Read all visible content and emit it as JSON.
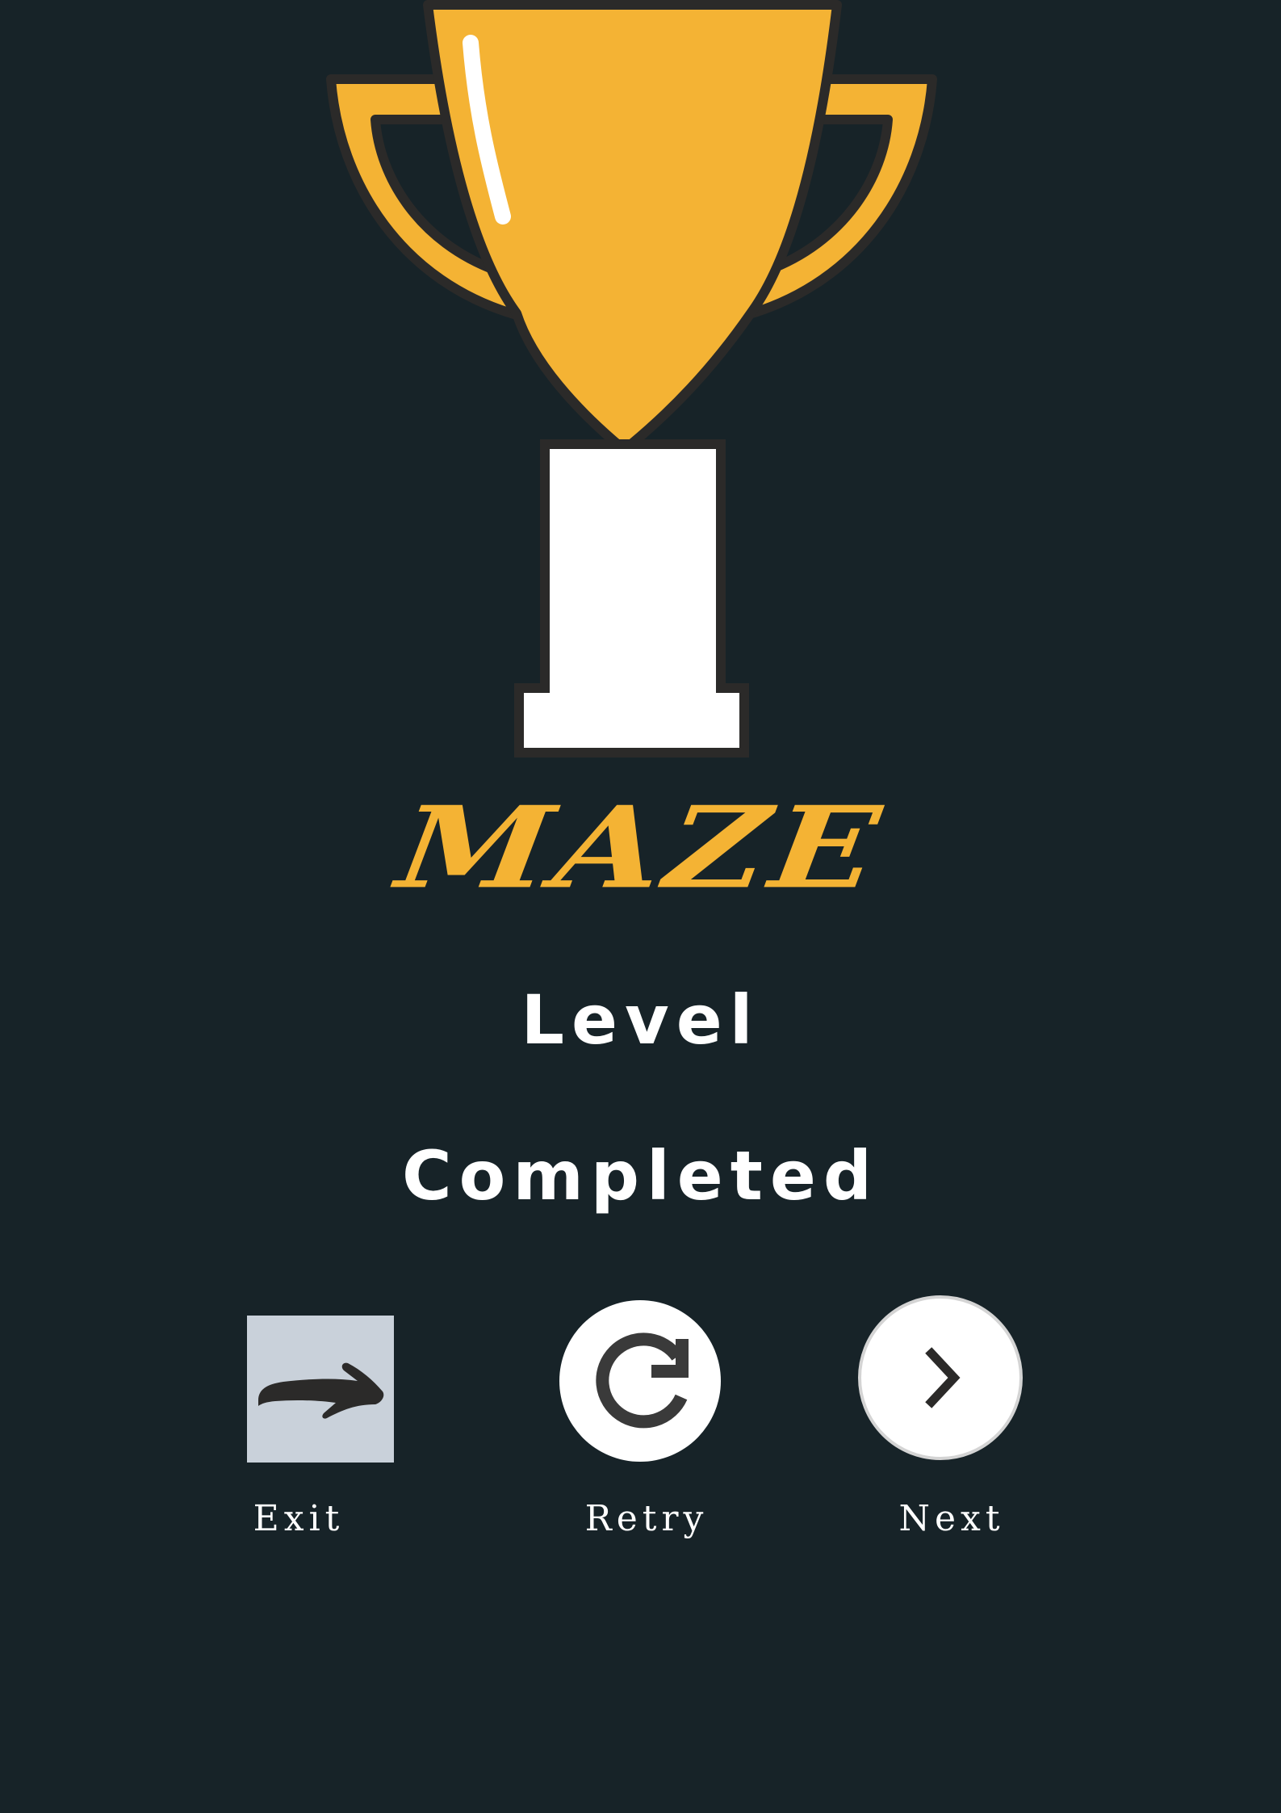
{
  "game": {
    "title": "MAZE"
  },
  "result": {
    "line1": "Level",
    "line2": "Completed"
  },
  "actions": {
    "exit_label": "Exit",
    "retry_label": "Retry",
    "next_label": "Next"
  },
  "icons": {
    "trophy": "trophy-icon",
    "exit": "arrow-right-icon",
    "retry": "refresh-icon",
    "next": "chevron-right-icon"
  },
  "colors": {
    "background": "#172328",
    "accent": "#f4b334",
    "text": "#ffffff",
    "outline": "#2b2a29",
    "exit_button": "#c9d1da"
  }
}
